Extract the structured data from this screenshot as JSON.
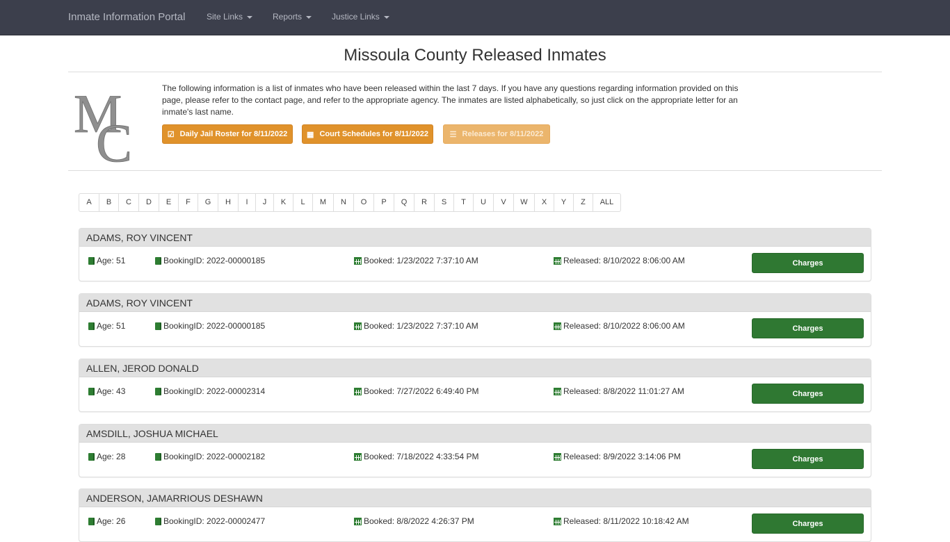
{
  "navbar": {
    "brand": "Inmate Information Portal",
    "items": [
      {
        "label": "Site Links",
        "icon": "caret-down-icon"
      },
      {
        "label": "Reports",
        "icon": "caret-down-icon"
      },
      {
        "label": "Justice Links",
        "icon": "caret-down-icon"
      }
    ]
  },
  "page": {
    "title": "Missoula County Released Inmates",
    "logo_text": "MC",
    "intro": "The following information is a list of inmates who have been released within the last 7 days. If you have any questions regarding information provided on this page, please refer to the contact page, and refer to the appropriate agency. The inmates are listed alphabetically, so just click on the appropriate letter for an inmate's last name.",
    "buttons": [
      {
        "label": "Daily Jail Roster for 8/11/2022",
        "icon": "check-square-icon",
        "disabled": false
      },
      {
        "label": "Court Schedules for 8/11/2022",
        "icon": "calendar-icon",
        "disabled": false
      },
      {
        "label": "Releases for 8/11/2022",
        "icon": "list-icon",
        "disabled": true
      }
    ]
  },
  "alphabet": [
    "A",
    "B",
    "C",
    "D",
    "E",
    "F",
    "G",
    "H",
    "I",
    "J",
    "K",
    "L",
    "M",
    "N",
    "O",
    "P",
    "Q",
    "R",
    "S",
    "T",
    "U",
    "V",
    "W",
    "X",
    "Y",
    "Z",
    "ALL"
  ],
  "inmates": [
    {
      "name": "ADAMS, ROY VINCENT",
      "age": "Age: 51",
      "booking_id": "BookingID: 2022-00000185",
      "booked": "Booked: 1/23/2022 7:37:10 AM",
      "released": "Released: 8/10/2022 8:06:00 AM",
      "button": "Charges"
    },
    {
      "name": "ADAMS, ROY VINCENT",
      "age": "Age: 51",
      "booking_id": "BookingID: 2022-00000185",
      "booked": "Booked: 1/23/2022 7:37:10 AM",
      "released": "Released: 8/10/2022 8:06:00 AM",
      "button": "Charges"
    },
    {
      "name": "ALLEN, JEROD DONALD",
      "age": "Age: 43",
      "booking_id": "BookingID: 2022-00002314",
      "booked": "Booked: 7/27/2022 6:49:40 PM",
      "released": "Released: 8/8/2022 11:01:27 AM",
      "button": "Charges"
    },
    {
      "name": "AMSDILL, JOSHUA MICHAEL",
      "age": "Age: 28",
      "booking_id": "BookingID: 2022-00002182",
      "booked": "Booked: 7/18/2022 4:33:54 PM",
      "released": "Released: 8/9/2022 3:14:06 PM",
      "button": "Charges"
    },
    {
      "name": "ANDERSON, JAMARRIOUS DESHAWN",
      "age": "Age: 26",
      "booking_id": "BookingID: 2022-00002477",
      "booked": "Booked: 8/8/2022 4:26:37 PM",
      "released": "Released: 8/11/2022 10:18:42 AM",
      "button": "Charges"
    }
  ],
  "colors": {
    "navbar": "#3c3f4c",
    "orange": "#e0922b",
    "green": "#2f7832",
    "panel_head": "#e1e1e1"
  }
}
